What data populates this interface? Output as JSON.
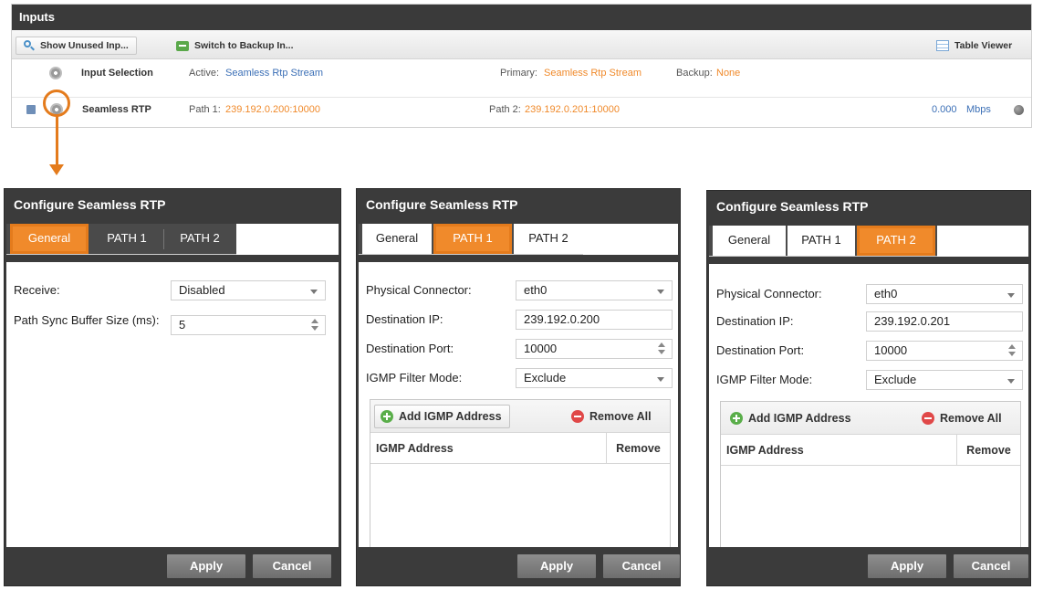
{
  "inputs_panel": {
    "title": "Inputs",
    "toolbar": {
      "show_unused": "Show Unused Inp...",
      "switch_backup": "Switch to Backup In...",
      "table_viewer": "Table Viewer"
    },
    "input_selection": {
      "label": "Input Selection",
      "active_label": "Active:",
      "active_value": "Seamless Rtp Stream",
      "primary_label": "Primary:",
      "primary_value": "Seamless Rtp Stream",
      "backup_label": "Backup:",
      "backup_value": "None"
    },
    "seamless_row": {
      "label": "Seamless RTP",
      "path1_label": "Path 1:",
      "path1_value": "239.192.0.200:10000",
      "path2_label": "Path 2:",
      "path2_value": "239.192.0.201:10000",
      "rate_value": "0.000",
      "rate_unit": "Mbps"
    }
  },
  "dialogs": [
    {
      "title": "Configure Seamless RTP",
      "tabs": [
        "General",
        "PATH 1",
        "PATH 2"
      ],
      "active_tab": "General",
      "receive_label": "Receive:",
      "receive_value": "Disabled",
      "buffer_label": "Path Sync Buffer Size (ms):",
      "buffer_value": "5",
      "apply": "Apply",
      "cancel": "Cancel"
    },
    {
      "title": "Configure Seamless RTP",
      "tabs": [
        "General",
        "PATH 1",
        "PATH 2"
      ],
      "active_tab": "PATH 1",
      "connector_label": "Physical Connector:",
      "connector_value": "eth0",
      "dest_ip_label": "Destination IP:",
      "dest_ip_value": "239.192.0.200",
      "dest_port_label": "Destination Port:",
      "dest_port_value": "10000",
      "igmp_mode_label": "IGMP Filter Mode:",
      "igmp_mode_value": "Exclude",
      "add_igmp": "Add IGMP Address",
      "remove_all": "Remove All",
      "col_address": "IGMP Address",
      "col_remove": "Remove",
      "apply": "Apply",
      "cancel": "Cancel"
    },
    {
      "title": "Configure Seamless RTP",
      "tabs": [
        "General",
        "PATH 1",
        "PATH 2"
      ],
      "active_tab": "PATH 2",
      "connector_label": "Physical Connector:",
      "connector_value": "eth0",
      "dest_ip_label": "Destination IP:",
      "dest_ip_value": "239.192.0.201",
      "dest_port_label": "Destination Port:",
      "dest_port_value": "10000",
      "igmp_mode_label": "IGMP Filter Mode:",
      "igmp_mode_value": "Exclude",
      "add_igmp": "Add IGMP Address",
      "remove_all": "Remove All",
      "col_address": "IGMP Address",
      "col_remove": "Remove",
      "apply": "Apply",
      "cancel": "Cancel"
    }
  ],
  "colors": {
    "accent_orange": "#f08a2b",
    "annotation_orange": "#e47b1c",
    "header_dark": "#3b3b3b",
    "link_blue": "#3b6fb6"
  }
}
